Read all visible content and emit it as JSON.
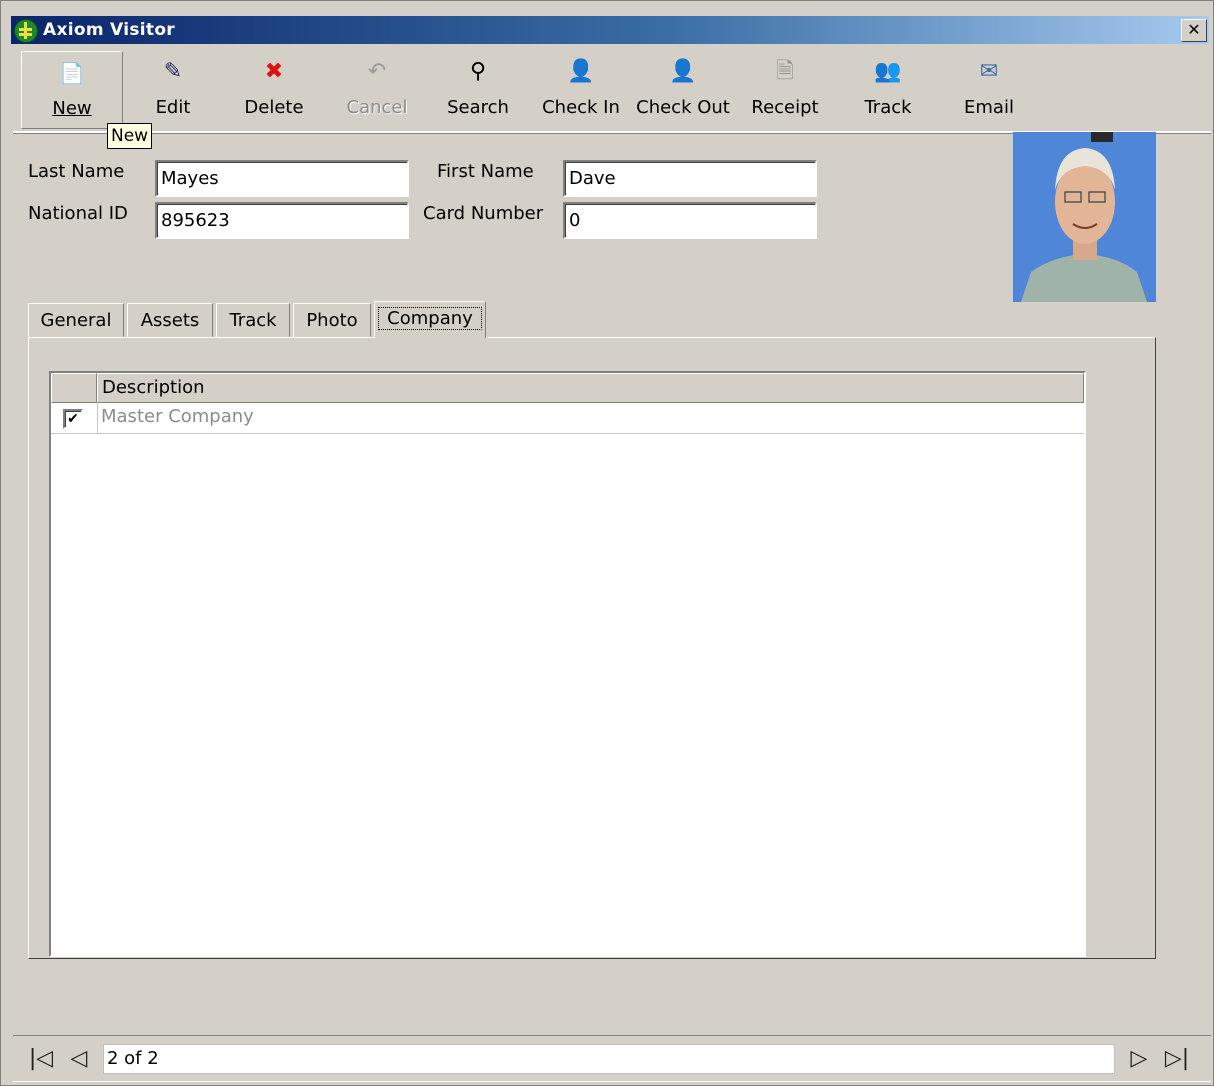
{
  "window": {
    "title": "Axiom Visitor",
    "close_glyph": "✕"
  },
  "toolbar": {
    "buttons": [
      {
        "label": "New",
        "icon": "new-document-icon",
        "glyph": "📄"
      },
      {
        "label": "Edit",
        "icon": "edit-icon",
        "glyph": "✎"
      },
      {
        "label": "Delete",
        "icon": "delete-icon",
        "glyph": "✖"
      },
      {
        "label": "Cancel",
        "icon": "undo-icon",
        "glyph": "↶"
      },
      {
        "label": "Search",
        "icon": "binoculars-icon",
        "glyph": "⚲"
      },
      {
        "label": "Check In",
        "icon": "user-checkin-icon",
        "glyph": "👤"
      },
      {
        "label": "Check Out",
        "icon": "user-checkout-icon",
        "glyph": "👤"
      },
      {
        "label": "Receipt",
        "icon": "receipt-icon",
        "glyph": "🗎"
      },
      {
        "label": "Track",
        "icon": "users-icon",
        "glyph": "👥"
      },
      {
        "label": "Email",
        "icon": "email-icon",
        "glyph": "✉"
      }
    ],
    "tooltip": "New"
  },
  "form": {
    "last_name_label": "Last Name",
    "last_name_value": "Mayes",
    "first_name_label": "First Name",
    "first_name_value": "Dave",
    "national_id_label": "National ID",
    "national_id_value": "895623",
    "card_number_label": "Card Number",
    "card_number_value": "0"
  },
  "tabs": [
    "General",
    "Assets",
    "Track",
    "Photo",
    "Company"
  ],
  "active_tab": "Company",
  "grid": {
    "header": "Description",
    "rows": [
      {
        "checked": true,
        "check_glyph": "✔",
        "text": "Master Company"
      }
    ]
  },
  "navigation": {
    "first_glyph": "|◁",
    "prev_glyph": "◁",
    "next_glyph": "▷",
    "last_glyph": "▷|",
    "record_text": "2 of 2"
  },
  "colors": {
    "title_start": "#0a246a",
    "title_end": "#a6caf0",
    "face": "#d4d0c8",
    "tooltip": "#ffffe1"
  }
}
